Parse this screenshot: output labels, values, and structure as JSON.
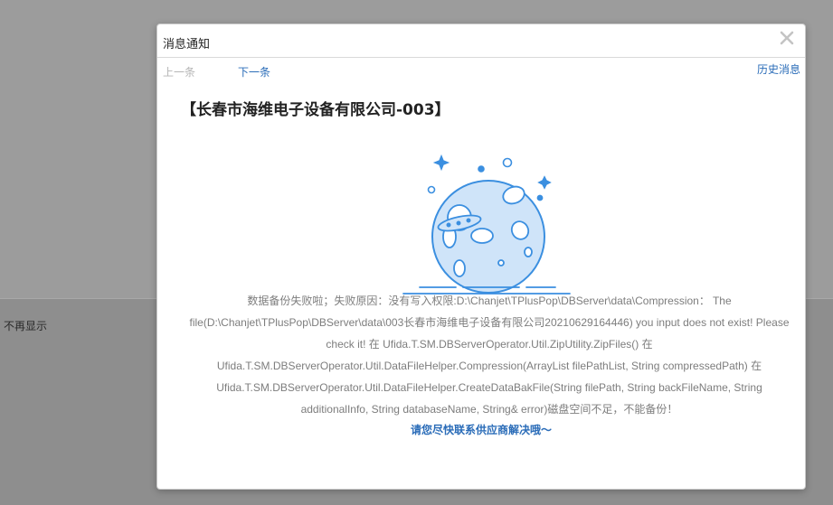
{
  "background": {
    "dont_show_label": "不再显示"
  },
  "modal": {
    "title": "消息通知",
    "close_icon": "close-icon",
    "nav": {
      "prev_label": "上一条",
      "next_label": "下一条",
      "history_label": "历史消息"
    },
    "company_title": "【长春市海维电子设备有限公司-003】",
    "illustration_icon": "planet-ufo-illustration",
    "message_lines": [
      "数据备份失败啦；失败原因：没有写入权限:D:\\Chanjet\\TPlusPop\\DBServer\\data\\Compression： The",
      "file(D:\\Chanjet\\TPlusPop\\DBServer\\data\\003长春市海维电子设备有限公司20210629164446) you input does not exist! Please",
      "check it! 在 Ufida.T.SM.DBServerOperator.Util.ZipUtility.ZipFiles() 在",
      "Ufida.T.SM.DBServerOperator.Util.DataFileHelper.Compression(ArrayList filePathList, String compressedPath) 在",
      "Ufida.T.SM.DBServerOperator.Util.DataFileHelper.CreateDataBakFile(String filePath, String backFileName, String",
      "additionalInfo, String databaseName, String& error)磁盘空间不足，不能备份！"
    ],
    "contact_text": "请您尽快联系供应商解决哦～"
  },
  "colors": {
    "link": "#2a6cb8",
    "disabled": "#b5b5b5",
    "illustration_stroke": "#3b8fe0",
    "illustration_fill": "#cfe4f9"
  }
}
